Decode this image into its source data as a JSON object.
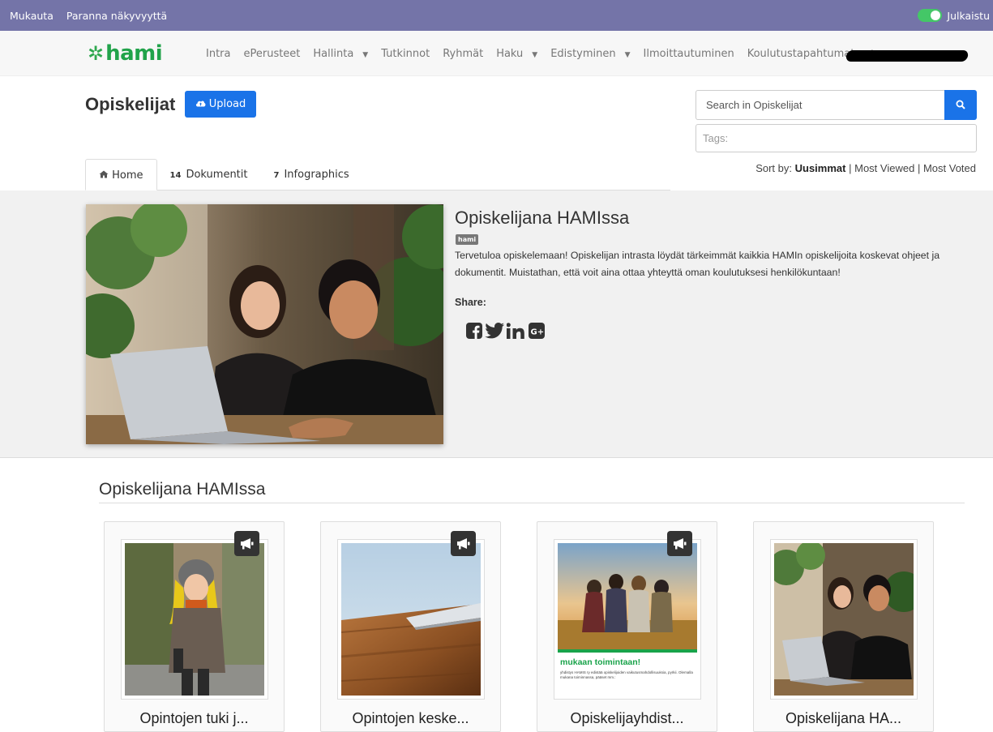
{
  "adminbar": {
    "customize": "Mukauta",
    "improve": "Paranna näkyvyyttä",
    "published": "Julkaistu"
  },
  "logo": {
    "text": "hami"
  },
  "nav": {
    "items": [
      {
        "label": "Intra"
      },
      {
        "label": "ePerusteet"
      },
      {
        "label": "Hallinta",
        "dropdown": true
      },
      {
        "label": "Tutkinnot"
      },
      {
        "label": "Ryhmät"
      },
      {
        "label": "Haku",
        "dropdown": true
      },
      {
        "label": "Edistyminen",
        "dropdown": true
      },
      {
        "label": "Ilmoittautuminen"
      },
      {
        "label": "Koulutustapahtumat"
      }
    ],
    "plus": "+"
  },
  "header": {
    "title": "Opiskelijat",
    "upload_label": "Upload",
    "search_placeholder": "Search in Opiskelijat",
    "tags_placeholder": "Tags:"
  },
  "sort": {
    "prefix": "Sort by:",
    "newest": "Uusimmat",
    "sep1": "|",
    "most_viewed": "Most Viewed",
    "sep2": "|",
    "most_voted": "Most Voted"
  },
  "tabs": [
    {
      "count": "",
      "label": "Home"
    },
    {
      "count": "14",
      "label": "Dokumentit"
    },
    {
      "count": "7",
      "label": "Infographics"
    }
  ],
  "hero": {
    "title": "Opiskelijana HAMIssa",
    "badge": "hami",
    "description": "Tervetuloa opiskelemaan! Opiskelijan intrasta löydät tärkeimmät kaikkia HAMIn opiskelijoita koskevat ohjeet ja dokumentit. Muistathan, että voit aina ottaa yhteyttä oman koulutuksesi henkilökuntaan!",
    "share_label": "Share:"
  },
  "section": {
    "title": "Opiskelijana HAMIssa"
  },
  "cards": [
    {
      "title": "Opintojen tuki j...",
      "megaphone": true
    },
    {
      "title": "Opintojen keske...",
      "megaphone": true
    },
    {
      "title": "Opiskelijayhdist...",
      "megaphone": true,
      "poster_text": "mukaan toimintaan!",
      "poster_small": "yhdistys HAMIS ry edistää opiskelijoiden vaikutusmahdollisuuksia, pyrkii. Olemalla mukana toiminnassa, pääset mm.:"
    },
    {
      "title": "Opiskelijana HA...",
      "megaphone": false
    }
  ],
  "colors": {
    "adminbar": "#7474a8",
    "primary": "#1a73e8",
    "logo_green": "#21a34a"
  }
}
